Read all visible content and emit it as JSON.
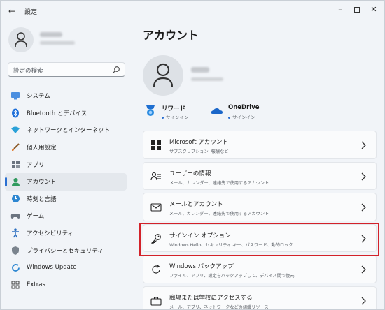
{
  "window": {
    "title": "設定"
  },
  "sidebar": {
    "search_placeholder": "設定の検索",
    "items": [
      {
        "label": "システム",
        "icon": "system-icon"
      },
      {
        "label": "Bluetooth とデバイス",
        "icon": "bluetooth-icon"
      },
      {
        "label": "ネットワークとインターネット",
        "icon": "network-icon"
      },
      {
        "label": "個人用設定",
        "icon": "brush-icon"
      },
      {
        "label": "アプリ",
        "icon": "apps-icon"
      },
      {
        "label": "アカウント",
        "icon": "account-icon",
        "active": true
      },
      {
        "label": "時刻と言語",
        "icon": "time-language-icon"
      },
      {
        "label": "ゲーム",
        "icon": "gaming-icon"
      },
      {
        "label": "アクセシビリティ",
        "icon": "accessibility-icon"
      },
      {
        "label": "プライバシーとセキュリティ",
        "icon": "shield-icon"
      },
      {
        "label": "Windows Update",
        "icon": "update-icon"
      },
      {
        "label": "Extras",
        "icon": "extras-icon"
      }
    ]
  },
  "main": {
    "title": "アカウント",
    "services": [
      {
        "name": "リワード",
        "status": "サインイン",
        "icon": "rewards-icon"
      },
      {
        "name": "OneDrive",
        "status": "サインイン",
        "icon": "onedrive-icon"
      }
    ],
    "cards": [
      {
        "title": "Microsoft アカウント",
        "subtitle": "サブスクリプション, 報酬など",
        "icon": "microsoft-icon"
      },
      {
        "title": "ユーザーの情報",
        "subtitle": "メール、カレンダー、連絡先で使用するアカウント",
        "icon": "user-info-icon"
      },
      {
        "title": "メールとアカウント",
        "subtitle": "メール、カレンダー、連絡先で使用するアカウント",
        "icon": "mail-icon"
      },
      {
        "title": "サインイン オプション",
        "subtitle": "Windows Hello、セキュリティ キー、パスワード、動的ロック",
        "icon": "key-icon"
      },
      {
        "title": "Windows バックアップ",
        "subtitle": "ファイル、アプリ、設定をバックアップして、デバイス間で復元",
        "icon": "backup-icon"
      },
      {
        "title": "職場または学校にアクセスする",
        "subtitle": "メール、アプリ、ネットワークなどの組織リソース",
        "icon": "briefcase-icon"
      }
    ]
  },
  "colors": {
    "accent": "#2a6fd1",
    "highlight": "#d3222a",
    "background": "#f1f4f8",
    "card": "#fafbfc"
  }
}
